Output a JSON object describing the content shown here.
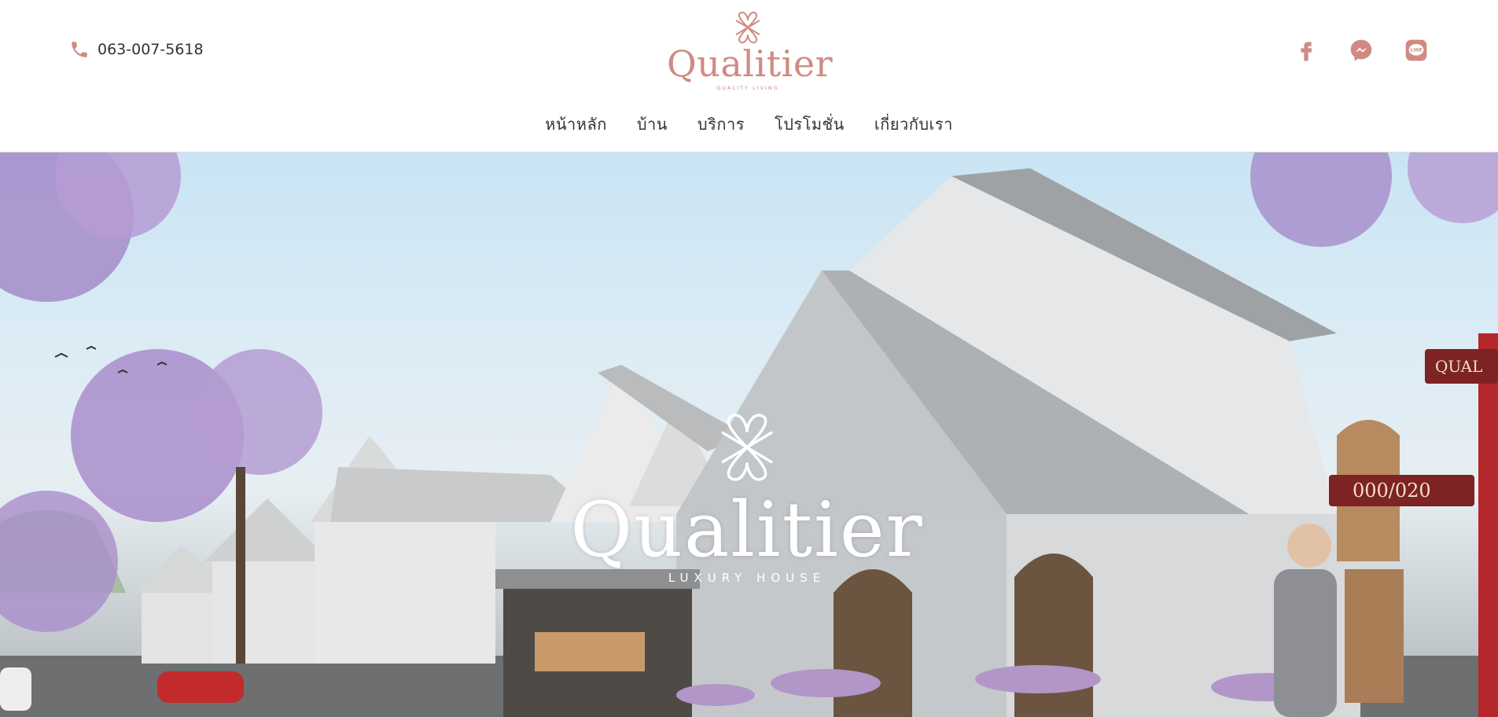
{
  "header": {
    "phone": "063-007-5618",
    "brand": {
      "name": "Qualitier",
      "tagline": "QUALITY   LIVING"
    },
    "social": [
      {
        "icon": "facebook-icon"
      },
      {
        "icon": "messenger-icon"
      },
      {
        "icon": "line-icon",
        "text": "LINE"
      }
    ]
  },
  "nav": {
    "items": [
      {
        "label": "หน้าหลัก"
      },
      {
        "label": "บ้าน"
      },
      {
        "label": "บริการ"
      },
      {
        "label": "โปรโมชั่น"
      },
      {
        "label": "เกี่ยวกับเรา"
      }
    ]
  },
  "hero": {
    "title": "Qualitier",
    "subtitle": "LUXURY HOUSE",
    "signs": {
      "street_sign": "QUAL",
      "house_number": "000/020"
    }
  },
  "colors": {
    "brand": "#cf8b83",
    "text": "#333333"
  }
}
